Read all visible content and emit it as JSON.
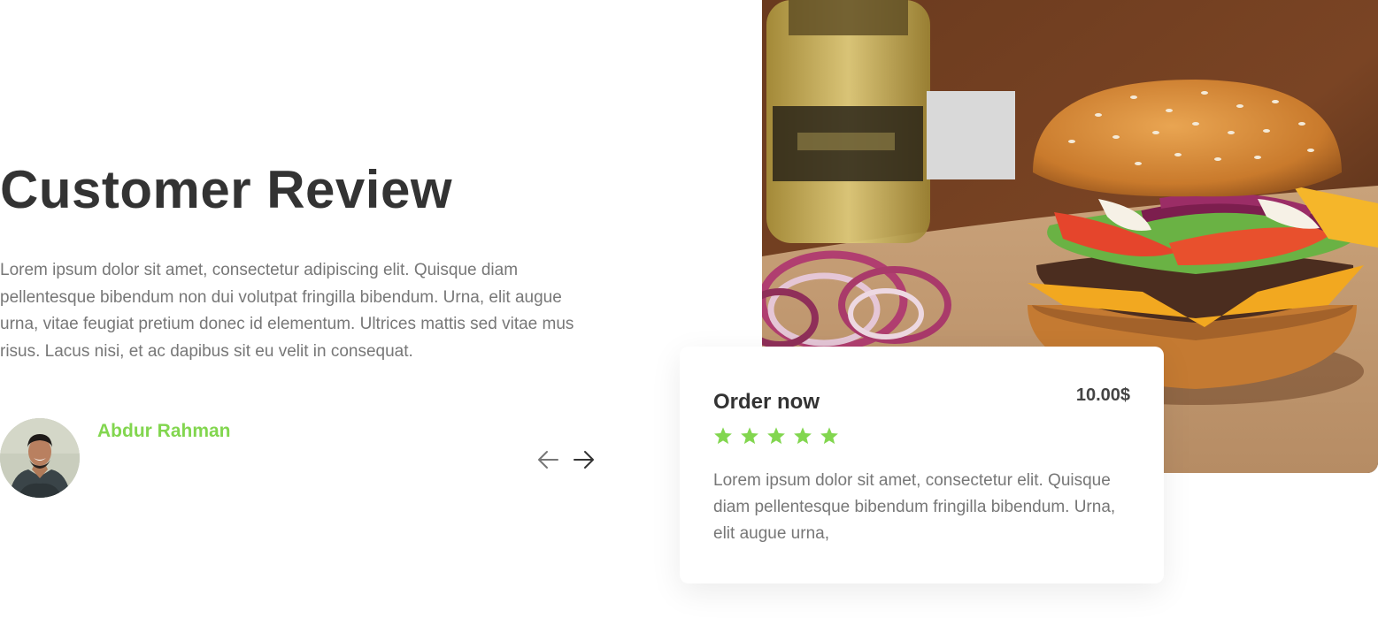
{
  "review": {
    "title": "Customer Review",
    "body": "Lorem ipsum dolor sit amet, consectetur adipiscing elit. Quisque diam pellentesque bibendum non dui volutpat fringilla bibendum. Urna, elit augue urna, vitae feugiat pretium donec id elementum. Ultrices mattis sed vitae mus risus. Lacus nisi, et ac dapibus sit eu velit in consequat.",
    "reviewer_name": "Abdur Rahman"
  },
  "navigation": {
    "prev_icon": "arrow-left-icon",
    "next_icon": "arrow-right-icon"
  },
  "order_card": {
    "title": "Order now",
    "price": "10.00$",
    "rating": 5,
    "rating_max": 5,
    "description": "Lorem ipsum dolor sit amet, consectetur elit. Quisque diam pellentesque bibendum fringilla bibendum. Urna, elit augue urna,"
  },
  "colors": {
    "heading": "#333333",
    "body_text": "#777777",
    "accent_green": "#82d64f",
    "card_background": "#ffffff",
    "placeholder": "#d9d9d9"
  }
}
